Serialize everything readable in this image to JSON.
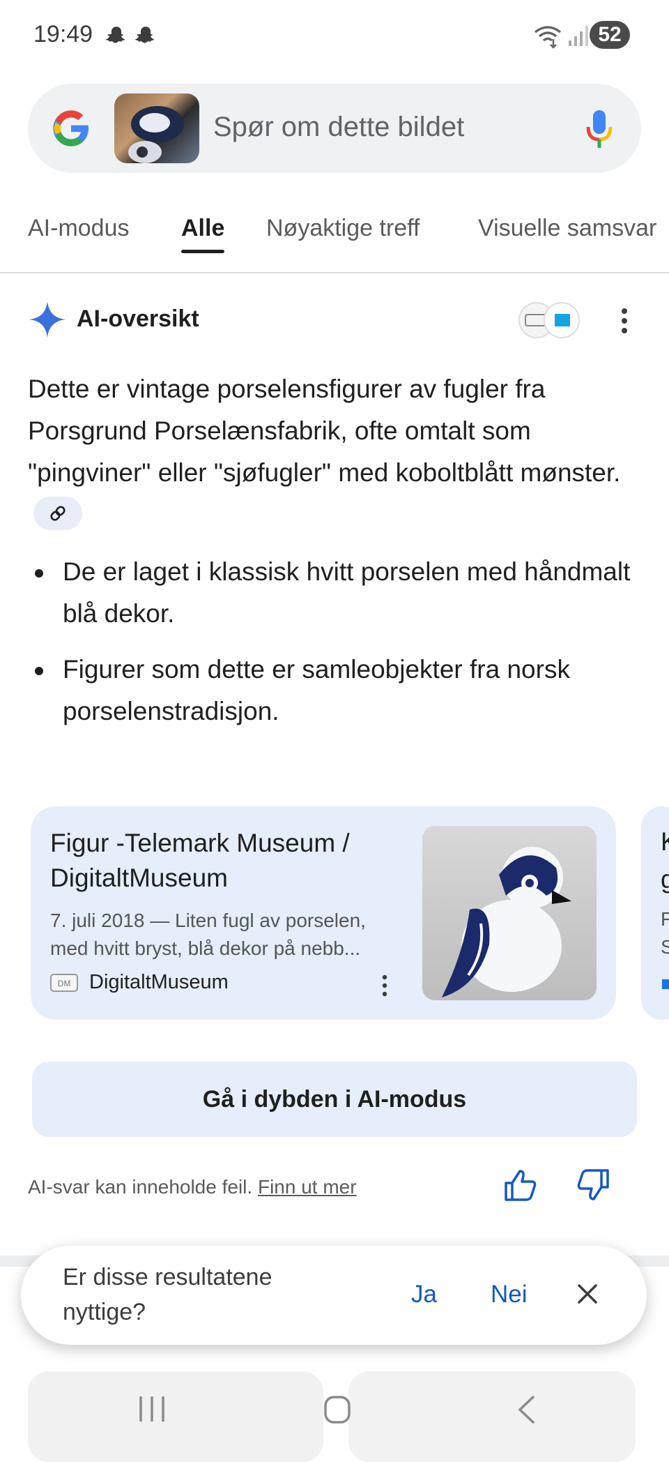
{
  "status_bar": {
    "time": "19:49",
    "battery": "52",
    "icons": [
      "snapchat-icon",
      "snapchat-icon",
      "wifi-icon",
      "signal-icon",
      "battery-icon"
    ]
  },
  "search": {
    "placeholder": "Spør om dette bildet"
  },
  "tabs": [
    {
      "label": "AI-modus",
      "active": false
    },
    {
      "label": "Alle",
      "active": true
    },
    {
      "label": "Nøyaktige treff",
      "active": false
    },
    {
      "label": "Visuelle samsvar",
      "active": false
    }
  ],
  "ai_overview": {
    "title": "AI-oversikt",
    "summary": "Dette er vintage porselensfigurer av fugler fra Porsgrund Porselænsfabrik, ofte omtalt som \"pingviner\" eller \"sjøfugler\" med koboltblått mønster.",
    "bullets": [
      "De er laget i klassisk hvitt porselen med håndmalt blå dekor.",
      "Figurer som dette er samleobjekter fra norsk porselenstradisjon."
    ]
  },
  "source_card": {
    "title": "Figur -Telemark Museum / DigitaltMuseum",
    "snippet": "7. juli 2018 — Liten fugl av porselen, med hvitt bryst, blå dekor på nebb...",
    "source_name": "DigitaltMuseum",
    "source_icon_text": "DM"
  },
  "next_card": {
    "title_start": "K",
    "line2_start": "g",
    "snippet_line1_start": "F",
    "snippet_line2_start": "S"
  },
  "deep_dive_label": "Gå i dybden i AI-modus",
  "disclaimer": {
    "text": "AI-svar kan inneholde feil.",
    "link": "Finn ut mer"
  },
  "feedback": {
    "question": "Er disse resultatene nyttige?",
    "yes": "Ja",
    "no": "Nei"
  },
  "colors": {
    "accent_blue": "#1558c0",
    "card_bg": "#e6edfb",
    "search_bg": "#eff1f3"
  }
}
